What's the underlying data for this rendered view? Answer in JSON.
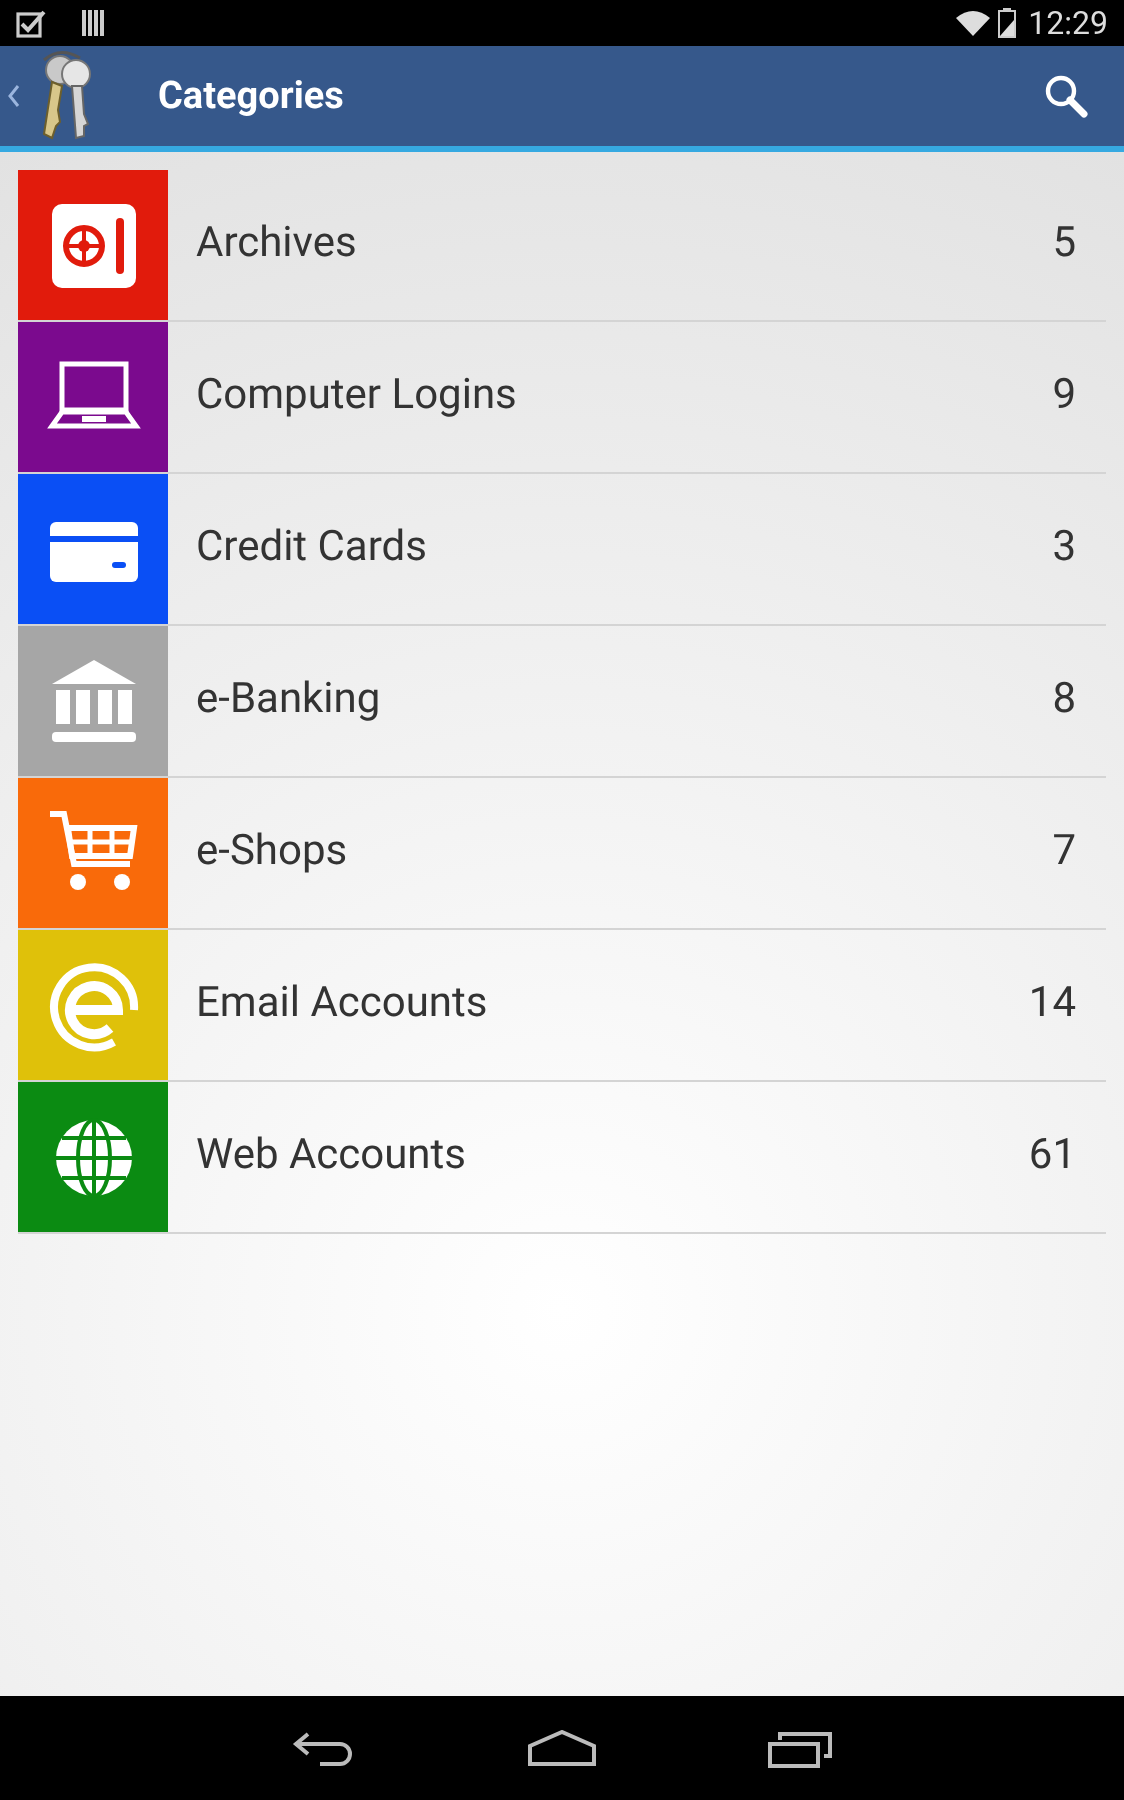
{
  "status_bar": {
    "time": "12:29"
  },
  "action_bar": {
    "title": "Categories"
  },
  "categories": [
    {
      "kind": "safe",
      "label": "Archives",
      "count": "5",
      "color": "#e11b0c"
    },
    {
      "kind": "laptop",
      "label": "Computer Logins",
      "count": "9",
      "color": "#7b0a8e"
    },
    {
      "kind": "card",
      "label": "Credit Cards",
      "count": "3",
      "color": "#0a4ff5"
    },
    {
      "kind": "bank",
      "label": "e-Banking",
      "count": "8",
      "color": "#a6a6a6"
    },
    {
      "kind": "cart",
      "label": "e-Shops",
      "count": "7",
      "color": "#f96a0a"
    },
    {
      "kind": "email",
      "label": "Email Accounts",
      "count": "14",
      "color": "#dfc10a"
    },
    {
      "kind": "globe",
      "label": "Web Accounts",
      "count": "61",
      "color": "#0b8b12"
    }
  ]
}
